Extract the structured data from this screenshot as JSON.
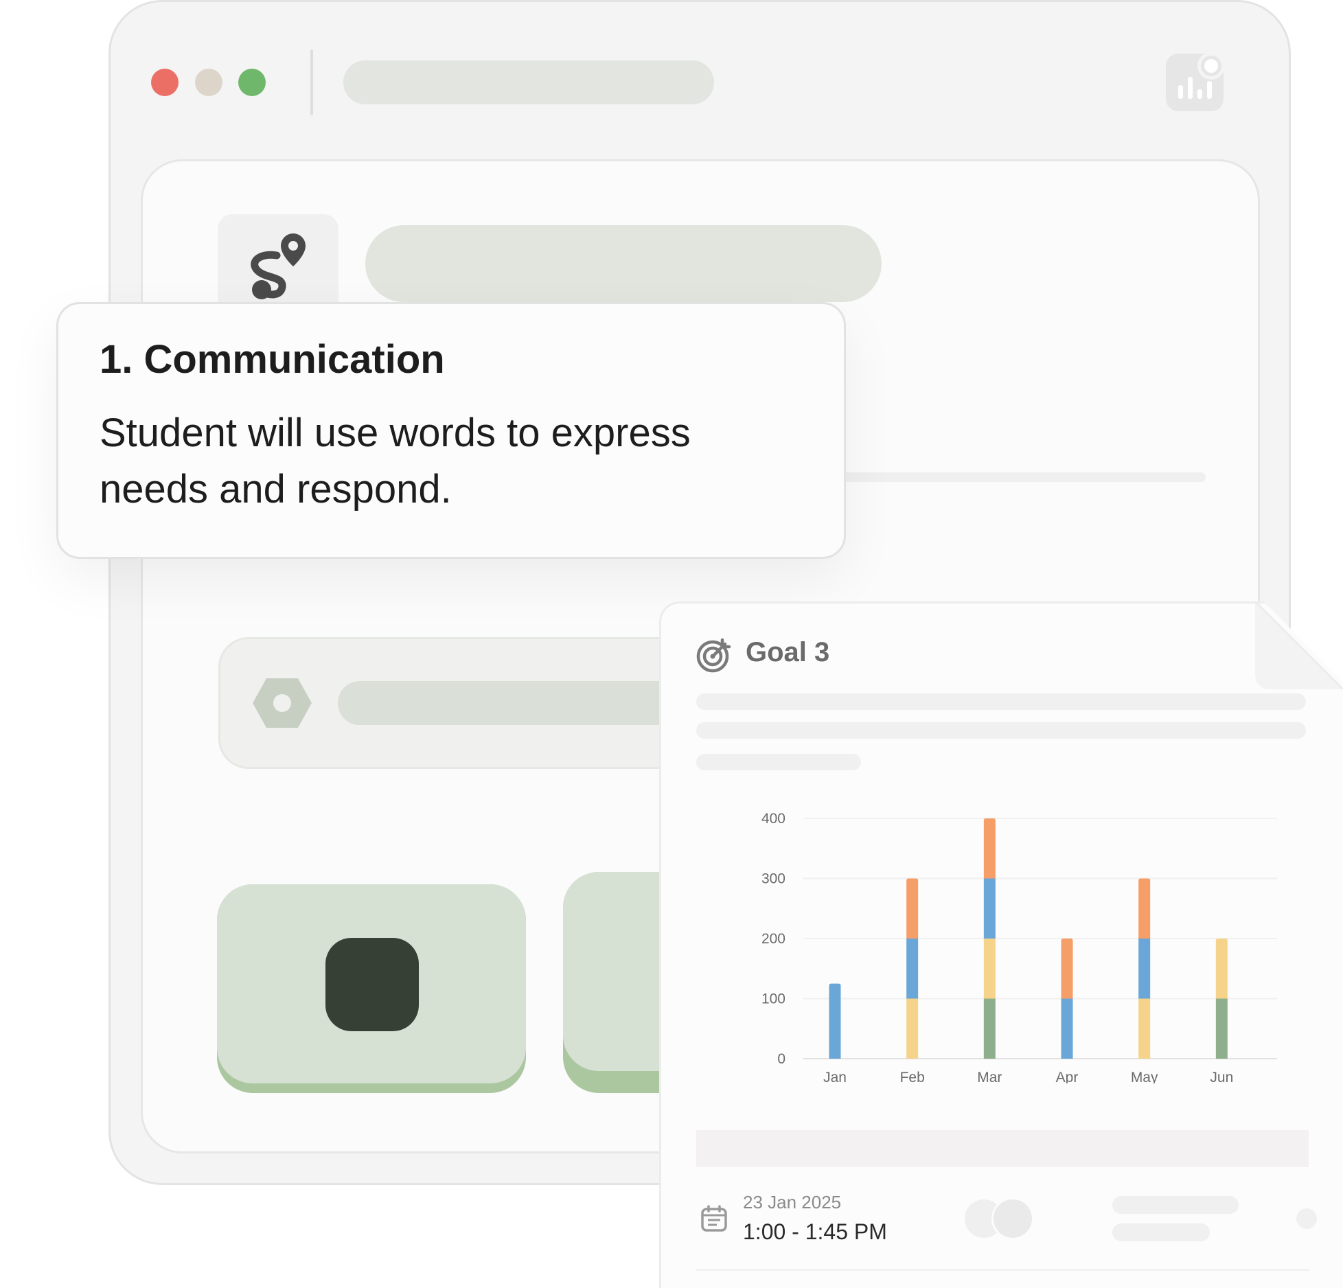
{
  "goal_card": {
    "title": "1. Communication",
    "description": "Student will use words to express needs and respond."
  },
  "report": {
    "title": "Goal 3",
    "date": "23 Jan 2025",
    "time": "1:00 - 1:45 PM"
  },
  "colors": {
    "close_dot": "#ec6f66",
    "minimize_dot": "#ddd5ca",
    "zoom_dot": "#6fb86b",
    "series_green": "#8fae8c",
    "series_yellow": "#f5d38b",
    "series_blue": "#6aa6d8",
    "series_orange": "#f59e68"
  },
  "icons": {
    "window_controls": [
      "close-dot",
      "minimize-dot",
      "zoom-dot"
    ],
    "toolbar": "stats-icon",
    "goal_header": "route-pin-icon",
    "goal_item": "hexagon-nut-icon",
    "record_button": "stop-icon",
    "report_title": "target-icon",
    "session": "calendar-icon"
  },
  "chart_data": {
    "type": "bar",
    "stacked": true,
    "categories": [
      "Jan",
      "Feb",
      "Mar",
      "Apr",
      "May",
      "Jun"
    ],
    "series": [
      {
        "color": "#8fae8c",
        "values": [
          0,
          0,
          100,
          0,
          0,
          100
        ]
      },
      {
        "color": "#f5d38b",
        "values": [
          0,
          100,
          100,
          0,
          100,
          100
        ]
      },
      {
        "color": "#6aa6d8",
        "values": [
          125,
          100,
          100,
          100,
          100,
          0
        ]
      },
      {
        "color": "#f59e68",
        "values": [
          0,
          100,
          100,
          100,
          100,
          0
        ]
      }
    ],
    "yticks": [
      0,
      100,
      200,
      300,
      400
    ],
    "ylim": [
      0,
      400
    ],
    "grid": true
  }
}
